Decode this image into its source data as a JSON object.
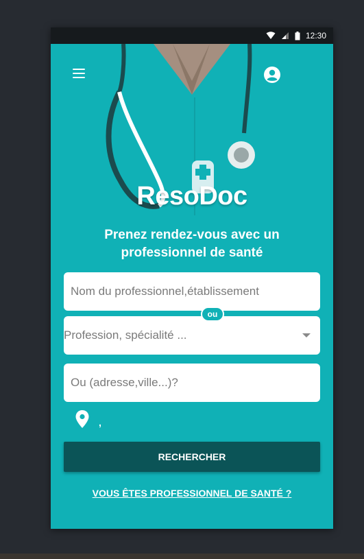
{
  "status_bar": {
    "time": "12:30",
    "icons": [
      "wifi-icon",
      "signal-icon",
      "battery-icon"
    ]
  },
  "header": {
    "menu_icon": "hamburger-menu-icon",
    "account_icon": "account-circle-icon"
  },
  "brand": {
    "name": "ResoDoc"
  },
  "tagline": "Prenez rendez-vous avec un professionnel de santé",
  "search": {
    "name_placeholder": "Nom du professionnel,établissement",
    "or_label": "ou",
    "profession_placeholder": "Profession, spécialité ...",
    "location_placeholder": "Ou (adresse,ville...)?",
    "current_location_text": ",",
    "submit_label": "RECHERCHER"
  },
  "footer_link": "VOUS ÊTES PROFESSIONNEL DE SANTÉ ?",
  "colors": {
    "primary": "#10b1b6",
    "dark_button": "#0b5457",
    "background": "#272b31"
  }
}
